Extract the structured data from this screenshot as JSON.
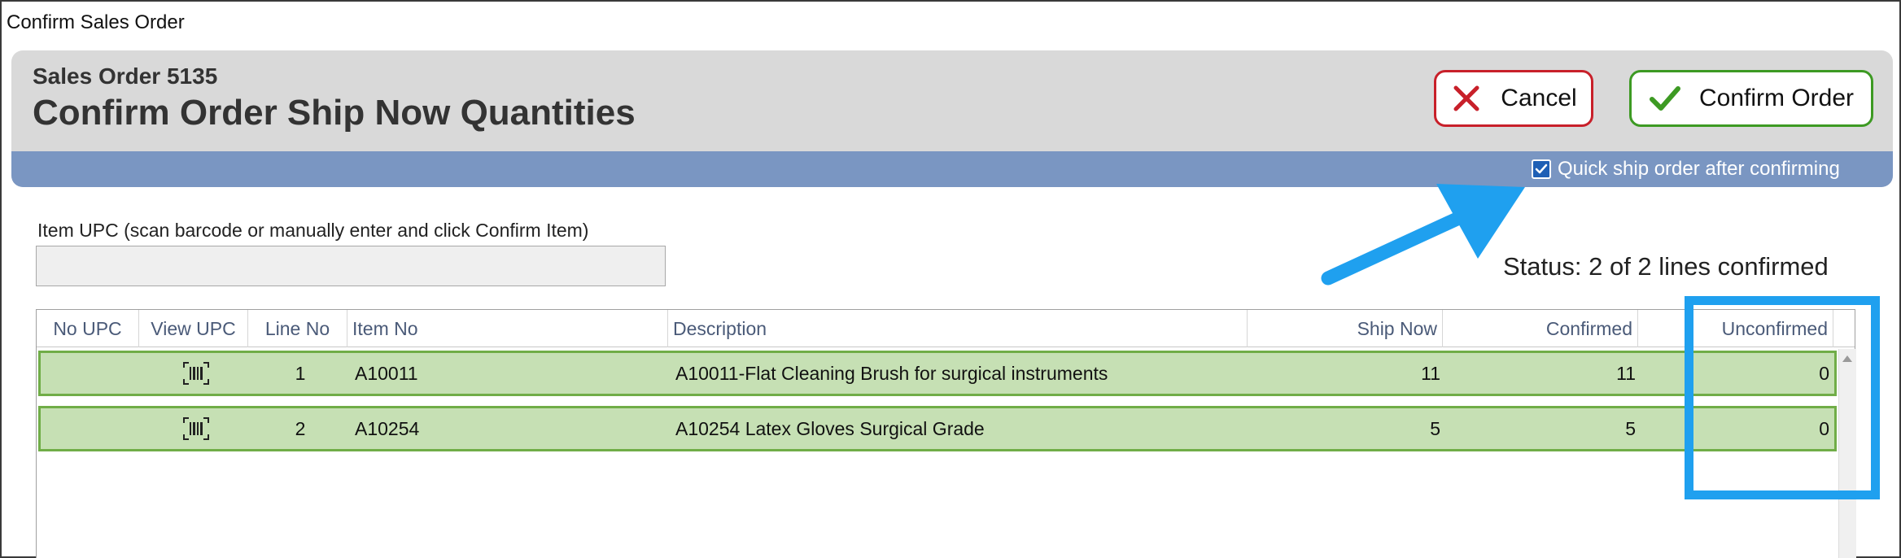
{
  "window": {
    "title": "Confirm Sales Order"
  },
  "header": {
    "subtitle": "Sales Order 5135",
    "title": "Confirm Order Ship Now Quantities"
  },
  "buttons": {
    "cancel_label": "Cancel",
    "confirm_label": "Confirm Order"
  },
  "quick_ship": {
    "label": "Quick ship order after confirming",
    "checked": true
  },
  "upc": {
    "label": "Item UPC (scan barcode or manually enter and click Confirm Item)",
    "value": ""
  },
  "status": "Status: 2 of 2 lines confirmed",
  "table": {
    "columns": [
      "No UPC",
      "View UPC",
      "Line No",
      "Item No",
      "Description",
      "Ship Now",
      "Confirmed",
      "Unconfirmed"
    ],
    "rows": [
      {
        "no_upc": "",
        "line_no": "1",
        "item_no": "A10011",
        "description": "A10011-Flat Cleaning Brush for surgical instruments",
        "ship_now": "11",
        "confirmed": "11",
        "unconfirmed": "0"
      },
      {
        "no_upc": "",
        "line_no": "2",
        "item_no": "A10254",
        "description": "A10254 Latex Gloves Surgical Grade",
        "ship_now": "5",
        "confirmed": "5",
        "unconfirmed": "0"
      }
    ]
  },
  "colors": {
    "header_bg": "#d9d9d9",
    "bar_blue": "#7a96c2",
    "cancel_border": "#c8202a",
    "confirm_border": "#3d9a23",
    "row_fill": "#c6e0b4",
    "row_border": "#70ad47",
    "annotation": "#1fa0ef"
  },
  "icons": {
    "cancel": "x-icon",
    "confirm": "checkmark-icon",
    "view_upc": "barcode-icon",
    "checkbox": "checkbox-checked-icon"
  }
}
